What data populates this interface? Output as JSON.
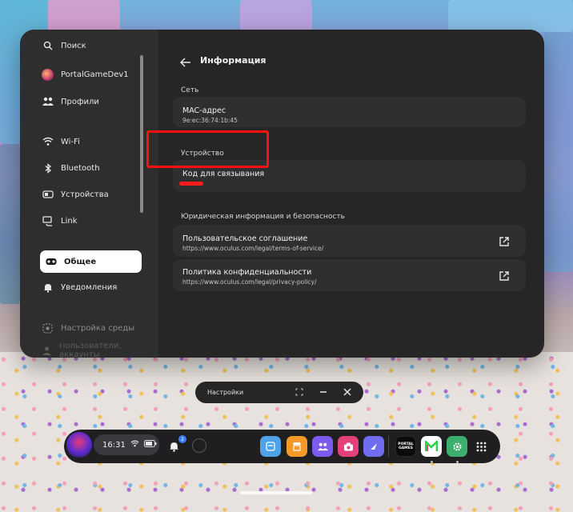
{
  "sidebar": {
    "items": [
      {
        "label": "Поиск",
        "icon": "search-icon"
      },
      {
        "label": "PortalGameDev1",
        "icon": "avatar-icon"
      },
      {
        "label": "Профили",
        "icon": "people-icon"
      },
      {
        "label": "Wi-Fi",
        "icon": "wifi-icon"
      },
      {
        "label": "Bluetooth",
        "icon": "bluetooth-icon"
      },
      {
        "label": "Устройства",
        "icon": "devices-icon"
      },
      {
        "label": "Link",
        "icon": "link-icon"
      },
      {
        "label": "Общее",
        "icon": "headset-icon",
        "active": true
      },
      {
        "label": "Уведомления",
        "icon": "bell-icon"
      },
      {
        "label": "Настройка среды",
        "icon": "environment-icon"
      },
      {
        "label": "Пользователи, аккаунты",
        "icon": "users-icon"
      }
    ]
  },
  "content": {
    "title": "Информация",
    "sections": [
      {
        "label": "Сеть",
        "cards": [
          {
            "title": "MAC-адрес",
            "sub": "9e:ec:36:74:1b:45"
          }
        ]
      },
      {
        "label": "Устройство",
        "cards": [
          {
            "title": "Код для связывания",
            "sub": ""
          }
        ]
      },
      {
        "label": "Юридическая информация и безопасность",
        "cards": [
          {
            "title": "Пользовательское соглашение",
            "sub": "https://www.oculus.com/legal/terms-of-service/"
          },
          {
            "title": "Политика конфиденциальности",
            "sub": "https://www.oculus.com/legal/privacy-policy/"
          }
        ]
      }
    ]
  },
  "mini_window": {
    "title": "Настройки"
  },
  "dock": {
    "time": "16:31",
    "notification_count": "2",
    "portal_label": "PORTAL\nGAMES"
  },
  "colors": {
    "highlight": "#ff1010",
    "active_bg": "#ffffff",
    "panel_bg": "#262626"
  }
}
